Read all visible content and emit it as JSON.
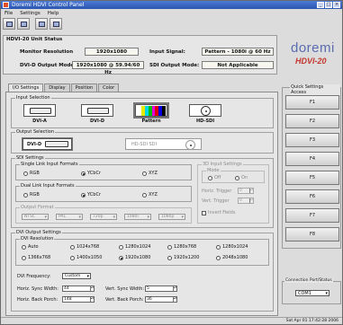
{
  "window": {
    "title": "Doremi HDVI Control Panel"
  },
  "menu": [
    "File",
    "Settings",
    "Help"
  ],
  "toolbar": [
    {
      "icon": "connect-icon"
    },
    {
      "icon": "disconnect-icon"
    },
    {
      "icon": "save-icon"
    },
    {
      "icon": "load-icon"
    }
  ],
  "unit_status": {
    "title": "HDVI-20 Unit Status",
    "monitor_resolution_label": "Monitor Resolution",
    "monitor_resolution_value": "1920x1080",
    "input_signal_label": "Input Signal:",
    "input_signal_value": "Pattern - 1080i @ 60 Hz",
    "dvi_output_mode_label": "DVI-D Output Mode:",
    "dvi_output_mode_value": "1920x1080 @ 59.94/60 Hz",
    "sdi_output_mode_label": "SDI Output Mode:",
    "sdi_output_mode_value": "Not Applicable"
  },
  "logo": {
    "word": "doremi",
    "model": "HDVI-20"
  },
  "tabs": [
    "I/O Settings",
    "Display",
    "Position",
    "Color"
  ],
  "input_selection": {
    "title": "Input Selection",
    "items": [
      {
        "label": "DVI-A",
        "selected": false
      },
      {
        "label": "DVI-D",
        "selected": false
      },
      {
        "label": "Pattern",
        "selected": true
      },
      {
        "label": "HD-SDI",
        "selected": false
      }
    ],
    "pattern_colors": [
      "#ffffff",
      "#e8e800",
      "#00d8e8",
      "#00c000",
      "#e000e0",
      "#e00000",
      "#0000e0",
      "#000000"
    ]
  },
  "output_selection": {
    "title": "Output Selection",
    "items": [
      {
        "label": "DVI-D"
      },
      {
        "label": "HD-SDI SDI"
      }
    ]
  },
  "sdi_settings": {
    "title": "SDI Settings",
    "single_link": {
      "title": "Single Link Input Formats",
      "options": [
        {
          "label": "RGB",
          "on": false
        },
        {
          "label": "YCbCr",
          "on": true
        },
        {
          "label": "XYZ",
          "on": false
        }
      ]
    },
    "dual_link": {
      "title": "Dual Link Input Formats",
      "options": [
        {
          "label": "RGB",
          "on": false
        },
        {
          "label": "YCbCr",
          "on": true
        },
        {
          "label": "XYZ",
          "on": false
        }
      ]
    },
    "output_format": {
      "title": "Output Format",
      "selects": [
        "NTSC",
        "PAL",
        "720p",
        "1080i",
        "1080p"
      ]
    },
    "3dsync": {
      "title": "3D Input Settings",
      "mode_label": "Mode",
      "mode_options": [
        "Off",
        "On"
      ],
      "h_trigger_label": "Horiz. Trigger",
      "h_trigger_value": "0",
      "v_trigger_label": "Vert. Trigger",
      "v_trigger_value": "0",
      "invert_label": "Invert Fields"
    }
  },
  "dvi_output": {
    "title": "DVI Output Settings",
    "resolution_title": "DVI Resolution",
    "resolutions": [
      {
        "label": "Auto",
        "on": false
      },
      {
        "label": "1024x768",
        "on": false
      },
      {
        "label": "1280x1024",
        "on": false
      },
      {
        "label": "1280x768",
        "on": false
      },
      {
        "label": "1280x1024",
        "on": false
      },
      {
        "label": "1366x768",
        "on": false
      },
      {
        "label": "1400x1050",
        "on": false
      },
      {
        "label": "1920x1080",
        "on": true
      },
      {
        "label": "1920x1200",
        "on": false
      },
      {
        "label": "2048x1080",
        "on": false
      }
    ],
    "frequency_label": "DVI Frequency:",
    "frequency_value": "Custom",
    "h_sync_width_label": "Horiz. Sync Width:",
    "h_sync_width_value": "44",
    "h_back_porch_label": "Horiz. Back Porch:",
    "h_back_porch_value": "148",
    "v_sync_width_label": "Vert. Sync Width:",
    "v_sync_width_value": "5",
    "v_back_porch_label": "Vert. Back Porch:",
    "v_back_porch_value": "36"
  },
  "quick_settings": {
    "title": "Quick Settings Access",
    "buttons": [
      "F1",
      "F2",
      "F3",
      "F4",
      "F5",
      "F6",
      "F7",
      "F8"
    ]
  },
  "connection": {
    "title": "Connection Port/Status",
    "port": "COM1"
  },
  "statusbar": {
    "text": "Sat Apr 01 17:42:28 2006"
  }
}
